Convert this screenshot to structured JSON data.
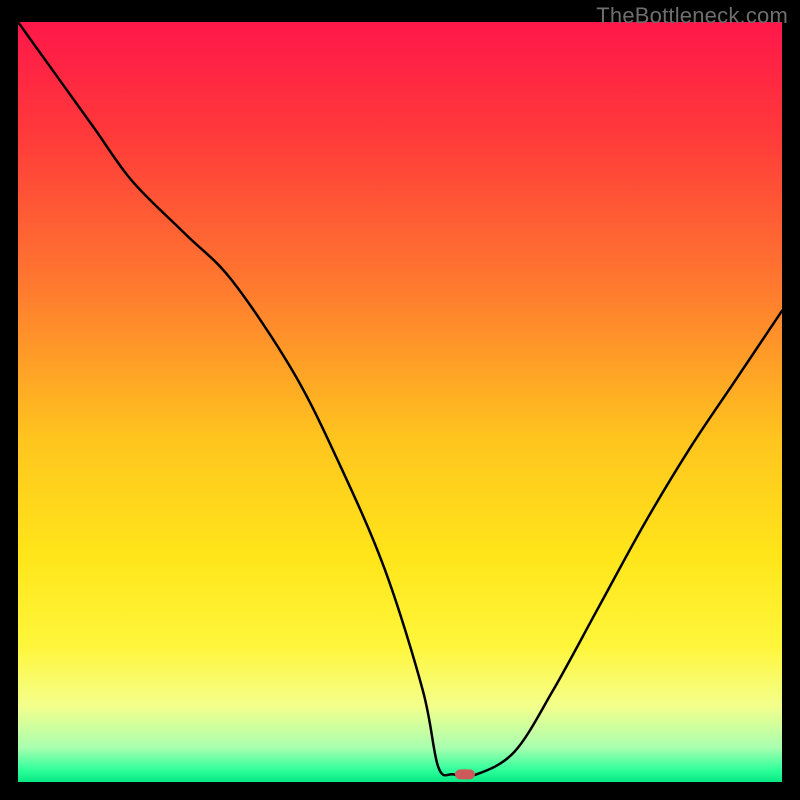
{
  "attribution": "TheBottleneck.com",
  "chart_data": {
    "type": "line",
    "title": "",
    "xlabel": "",
    "ylabel": "",
    "xlim": [
      0,
      100
    ],
    "ylim": [
      0,
      100
    ],
    "x": [
      0,
      5,
      10,
      15,
      22,
      28,
      36,
      42,
      48,
      53,
      55,
      57,
      60,
      65,
      70,
      76,
      82,
      88,
      94,
      100
    ],
    "values": [
      100,
      93,
      86,
      79,
      72,
      66,
      54,
      42,
      28,
      12,
      2,
      1,
      1,
      4,
      12,
      23,
      34,
      44,
      53,
      62
    ],
    "marker": {
      "x": 58.5,
      "y": 1
    },
    "gradient_bands": [
      {
        "stop": 0.0,
        "color": "#ff174a"
      },
      {
        "stop": 0.15,
        "color": "#ff3a3a"
      },
      {
        "stop": 0.35,
        "color": "#ff7a2f"
      },
      {
        "stop": 0.55,
        "color": "#ffc51e"
      },
      {
        "stop": 0.7,
        "color": "#ffe51a"
      },
      {
        "stop": 0.82,
        "color": "#fff63a"
      },
      {
        "stop": 0.9,
        "color": "#f4ff8c"
      },
      {
        "stop": 0.955,
        "color": "#a8ffb0"
      },
      {
        "stop": 0.985,
        "color": "#2cff9a"
      },
      {
        "stop": 1.0,
        "color": "#07e882"
      }
    ],
    "curve_color": "#000000",
    "marker_color": "#cc5a5a"
  }
}
